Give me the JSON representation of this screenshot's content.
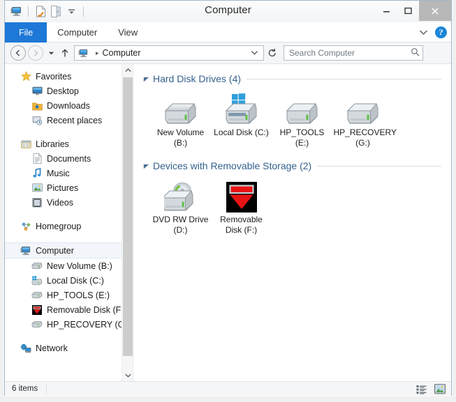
{
  "window": {
    "title": "Computer",
    "minimize_label": "–",
    "maximize_label": "□",
    "close_label": "✕"
  },
  "quick_access": {
    "items": [
      {
        "name": "computer-icon",
        "label": "Computer"
      },
      {
        "name": "properties-icon",
        "label": "Properties"
      },
      {
        "name": "open-icon",
        "label": "Open"
      },
      {
        "name": "customize-dropdown-icon",
        "label": "Customize Quick Access Toolbar"
      }
    ]
  },
  "ribbon": {
    "tabs": [
      {
        "label": "File",
        "active": true
      },
      {
        "label": "Computer",
        "active": false
      },
      {
        "label": "View",
        "active": false
      }
    ],
    "expand_label": "⌄",
    "help_label": "?"
  },
  "nav": {
    "back_label": "←",
    "forward_label": "→",
    "recent_label": "▾",
    "up_label": "↑",
    "refresh_label": "↻",
    "address": {
      "crumb": "Computer",
      "separator": "▸",
      "dropdown": "⌄"
    },
    "search": {
      "placeholder": "Search Computer",
      "value": "",
      "icon": "search-icon"
    }
  },
  "sidebar": {
    "groups": [
      {
        "header": {
          "label": "Favorites",
          "icon": "star-icon"
        },
        "items": [
          {
            "label": "Desktop",
            "icon": "desktop-icon"
          },
          {
            "label": "Downloads",
            "icon": "downloads-folder-icon"
          },
          {
            "label": "Recent places",
            "icon": "recent-places-icon"
          }
        ]
      },
      {
        "header": {
          "label": "Libraries",
          "icon": "libraries-icon"
        },
        "items": [
          {
            "label": "Documents",
            "icon": "document-icon"
          },
          {
            "label": "Music",
            "icon": "music-note-icon"
          },
          {
            "label": "Pictures",
            "icon": "picture-icon"
          },
          {
            "label": "Videos",
            "icon": "video-film-icon"
          }
        ]
      },
      {
        "header": {
          "label": "Homegroup",
          "icon": "homegroup-icon"
        },
        "items": []
      },
      {
        "header": {
          "label": "Computer",
          "icon": "computer-icon",
          "selected": true
        },
        "items": [
          {
            "label": "New Volume (B:)",
            "icon": "hard-drive-icon"
          },
          {
            "label": "Local Disk (C:)",
            "icon": "windows-drive-icon"
          },
          {
            "label": "HP_TOOLS (E:)",
            "icon": "hard-drive-icon"
          },
          {
            "label": "Removable Disk (F:)",
            "icon": "removable-red-icon"
          },
          {
            "label": "HP_RECOVERY (G:)",
            "icon": "hard-drive-icon"
          }
        ]
      },
      {
        "header": {
          "label": "Network",
          "icon": "network-icon"
        },
        "items": []
      }
    ],
    "scroll": {
      "up_label": "▲",
      "down_label": "▼"
    }
  },
  "main": {
    "groups": [
      {
        "title": "Hard Disk Drives (4)",
        "collapse_label": "◢",
        "items": [
          {
            "label": "New Volume (B:)",
            "icon": "hard-drive-icon"
          },
          {
            "label": "Local Disk (C:)",
            "icon": "windows-drive-icon"
          },
          {
            "label": "HP_TOOLS (E:)",
            "icon": "hard-drive-icon"
          },
          {
            "label": "HP_RECOVERY (G:)",
            "icon": "hard-drive-icon"
          }
        ]
      },
      {
        "title": "Devices with Removable Storage (2)",
        "collapse_label": "◢",
        "items": [
          {
            "label": "DVD RW Drive (D:)",
            "icon": "dvd-drive-icon"
          },
          {
            "label": "Removable Disk (F:)",
            "icon": "removable-red-icon"
          }
        ]
      }
    ]
  },
  "statusbar": {
    "item_count": "6 items",
    "views": [
      {
        "name": "details-view-button",
        "label": "Details view"
      },
      {
        "name": "large-icons-view-button",
        "label": "Large icons view"
      }
    ]
  },
  "colors": {
    "accent_blue": "#1e78d7",
    "group_header_blue": "#34618f",
    "selection_bg": "#f2f6fa",
    "window_bg": "#ffffff",
    "chrome_bg": "#f4f6f8"
  }
}
